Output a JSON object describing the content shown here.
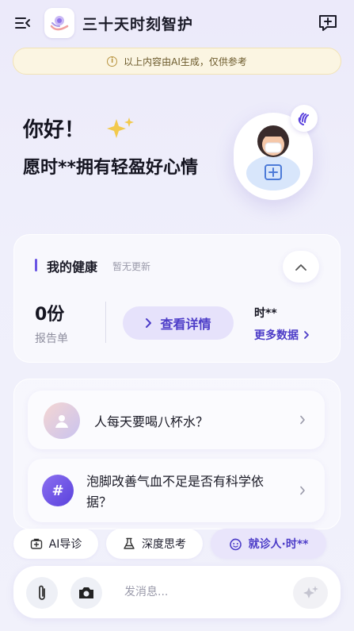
{
  "header": {
    "app_title": "三十天时刻智护",
    "icons": {
      "menu": "menu-collapse-icon",
      "logo": "app-logo-icon",
      "new_chat": "new-chat-icon"
    }
  },
  "notice": {
    "text": "以上内容由AI生成，仅供参考",
    "icon": "info-icon"
  },
  "greeting": {
    "hello": "你好！",
    "wish": "愿时**拥有轻盈好心情"
  },
  "health": {
    "title": "我的健康",
    "subtitle": "暂无更新",
    "report_count": "0份",
    "report_label": "报告单",
    "view_detail": "查看详情",
    "user_name": "时**",
    "more_data": "更多数据"
  },
  "questions": [
    {
      "text": "人每天要喝八杯水？"
    },
    {
      "text": "泡脚改善气血不足是否有科学依据？"
    }
  ],
  "chips": {
    "ai_guide": "AI导诊",
    "deep_think": "深度思考",
    "patient": "就诊人·时**"
  },
  "input": {
    "placeholder": "发消息..."
  },
  "colors": {
    "accent": "#4d3dc8",
    "accent_bg": "#e6e2fb",
    "notice_bg": "#fbf5e2"
  }
}
